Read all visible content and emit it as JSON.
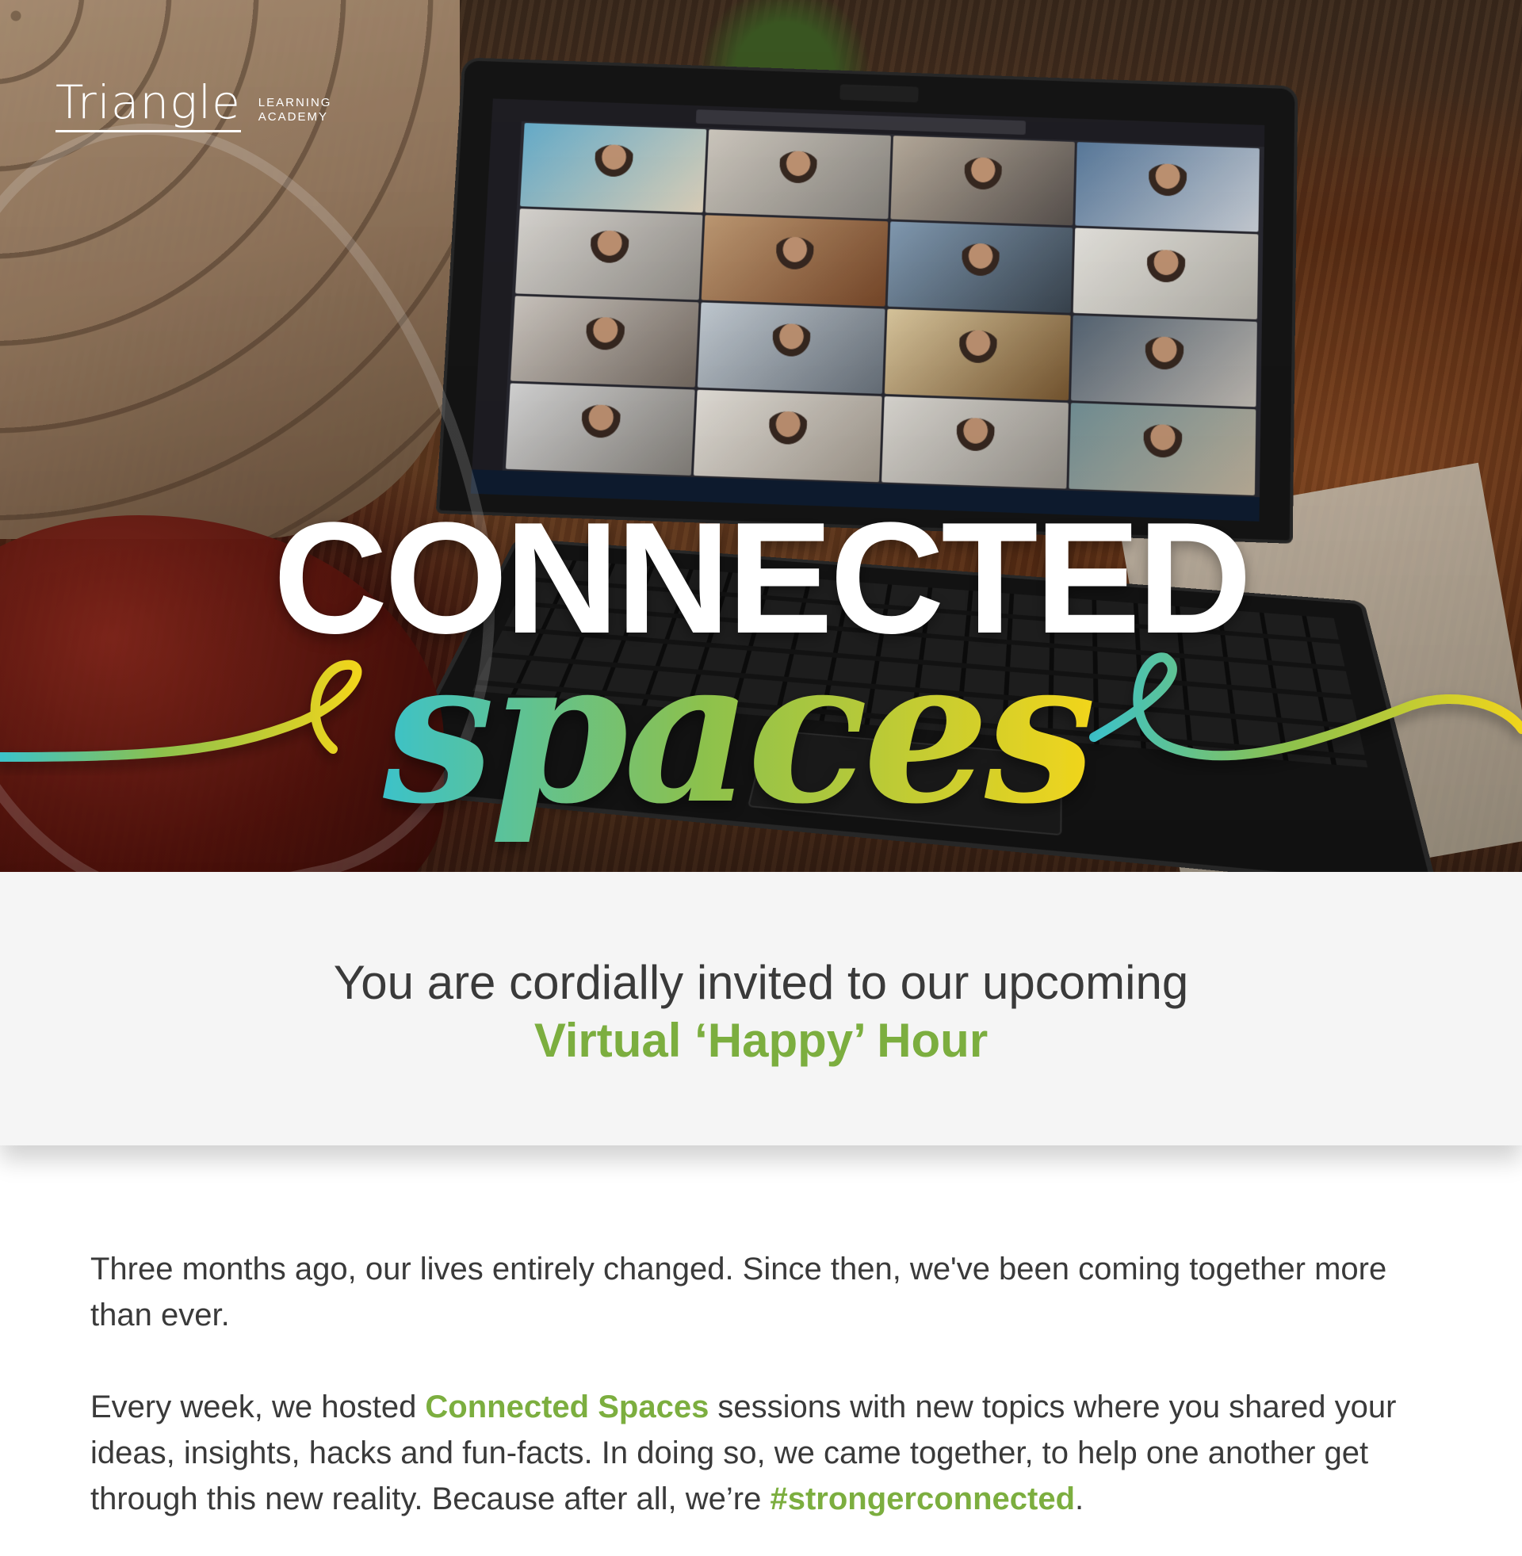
{
  "brand": {
    "logo_word": "Triangle",
    "logo_sub_line1": "LEARNING",
    "logo_sub_line2": "ACADEMY"
  },
  "hero": {
    "title": "CONNECTED",
    "script_title": "spaces",
    "gradient_start": "#3cc2c9",
    "gradient_mid": "#8cc14d",
    "gradient_end": "#f1d51c"
  },
  "invite": {
    "line1": "You are cordially invited to our upcoming",
    "line2": "Virtual ‘Happy’ Hour"
  },
  "body": {
    "para1": "Three months ago, our lives entirely changed. Since then, we've been coming together more than ever.",
    "para2_before": "Every week, we hosted ",
    "para2_highlight": "Connected Spaces",
    "para2_after": " sessions with new topics where you shared your ideas, insights, hacks and fun-facts. In doing so, we came together, to help one another get through this new reality. Because after all, we’re ",
    "para2_hashtag": "#strongerconnected",
    "para2_end": "."
  },
  "colors": {
    "accent_green": "#7cae3f",
    "text_dark": "#3a3a3a",
    "invite_bg": "#f5f5f5"
  }
}
